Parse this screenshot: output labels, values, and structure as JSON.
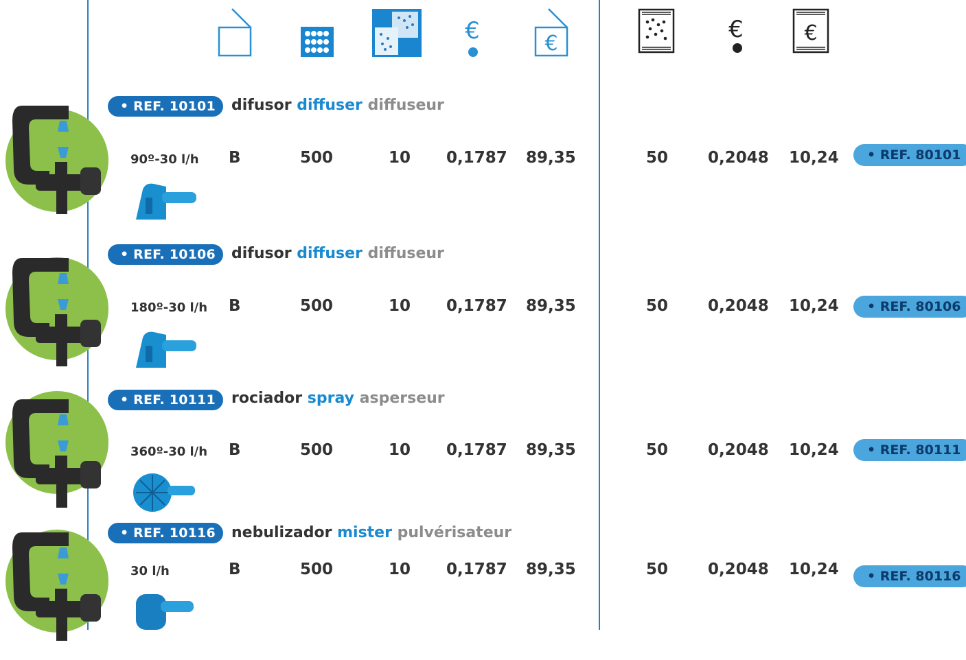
{
  "header_icons": [
    {
      "name": "box-icon"
    },
    {
      "name": "grid-pack-icon"
    },
    {
      "name": "packs-icon"
    },
    {
      "name": "unit-price-euro-icon"
    },
    {
      "name": "box-price-euro-icon"
    },
    {
      "name": "bag-icon"
    },
    {
      "name": "bag-unit-price-euro-icon"
    },
    {
      "name": "bag-price-euro-icon"
    }
  ],
  "colors": {
    "ref_pill": "#1a70b8",
    "ref_right": "#4aa6dc",
    "circle": "#8cc04a",
    "english_text": "#1a8ad0",
    "french_text": "#8c8c8c",
    "divider": "#2a7fc0"
  },
  "rows": [
    {
      "ref": "• REF. 10101",
      "title_es": "difusor",
      "title_en": "diffuser",
      "title_fr": "diffuseur",
      "flow": "90º-30 l/h",
      "type": "B",
      "qty": "500",
      "packs": "10",
      "unit_price": "0,1787",
      "box_price": "89,35",
      "bag_qty": "50",
      "bag_unit_price": "0,2048",
      "bag_price": "10,24",
      "ref_bag": "• REF. 80101"
    },
    {
      "ref": "• REF. 10106",
      "title_es": "difusor",
      "title_en": "diffuser",
      "title_fr": "diffuseur",
      "flow": "180º-30 l/h",
      "type": "B",
      "qty": "500",
      "packs": "10",
      "unit_price": "0,1787",
      "box_price": "89,35",
      "bag_qty": "50",
      "bag_unit_price": "0,2048",
      "bag_price": "10,24",
      "ref_bag": "• REF. 80106"
    },
    {
      "ref": "• REF. 10111",
      "title_es": "rociador",
      "title_en": "spray",
      "title_fr": "asperseur",
      "flow": "360º-30 l/h",
      "type": "B",
      "qty": "500",
      "packs": "10",
      "unit_price": "0,1787",
      "box_price": "89,35",
      "bag_qty": "50",
      "bag_unit_price": "0,2048",
      "bag_price": "10,24",
      "ref_bag": "• REF. 80111"
    },
    {
      "ref": "• REF. 10116",
      "title_es": "nebulizador",
      "title_en": "mister",
      "title_fr": "pulvérisateur",
      "flow": "30 l/h",
      "type": "B",
      "qty": "500",
      "packs": "10",
      "unit_price": "0,1787",
      "box_price": "89,35",
      "bag_qty": "50",
      "bag_unit_price": "0,2048",
      "bag_price": "10,24",
      "ref_bag": "• REF. 80116"
    }
  ]
}
